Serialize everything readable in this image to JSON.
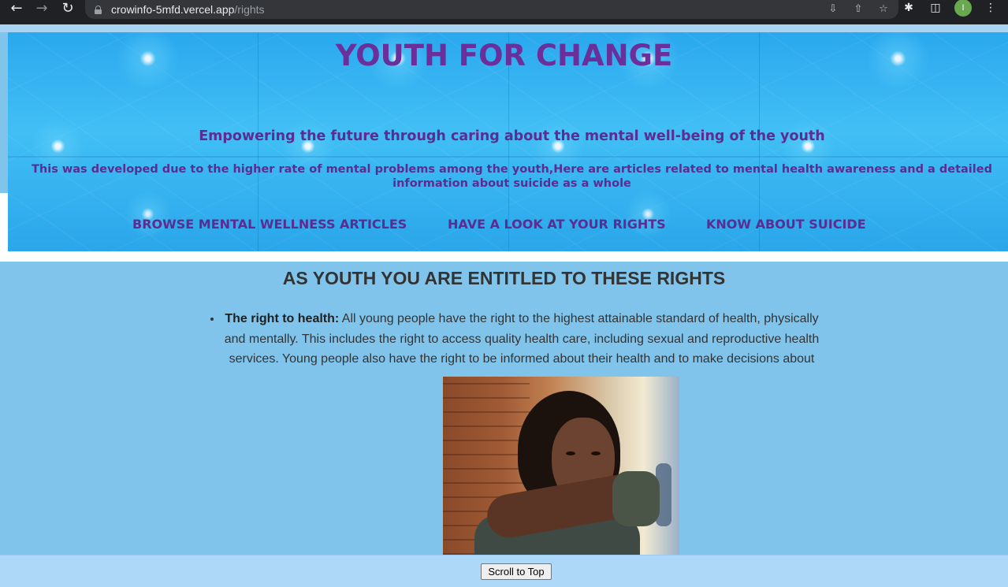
{
  "browser": {
    "url_host": "crowinfo-5mfd.vercel.app",
    "url_path": "/rights",
    "avatar_letter": "I",
    "icons": [
      "back-arrow-icon",
      "forward-arrow-icon",
      "reload-icon",
      "lock-icon",
      "install-icon",
      "share-icon",
      "star-icon",
      "puzzle-extension-icon",
      "side-panel-icon",
      "kebab-menu-icon"
    ]
  },
  "header": {
    "title": "YOUTH FOR CHANGE",
    "subtitle": "Empowering the future through caring about the mental well-being of the youth",
    "description": "This was developed due to the higher rate of mental problems among the youth,Here are articles related to mental health awareness and a detailed information about suicide as a whole",
    "nav": [
      {
        "label": "BROWSE MENTAL WELLNESS ARTICLES"
      },
      {
        "label": "HAVE A LOOK AT YOUR RIGHTS"
      },
      {
        "label": "KNOW ABOUT SUICIDE"
      }
    ]
  },
  "main": {
    "heading": "AS YOUTH YOU ARE ENTITLED TO THESE RIGHTS",
    "rights": [
      {
        "title": "The right to health:",
        "text": " All young people have the right to the highest attainable standard of health, physically and mentally. This includes the right to access quality health care, including sexual and reproductive health services. Young people also have the right to be informed about their health and to make decisions about"
      }
    ]
  },
  "footer": {
    "scroll_label": "Scroll to Top"
  },
  "colors": {
    "title_purple": "#6a2f9a",
    "text_purple": "#5b2c91",
    "page_bg": "#80c4ec",
    "footer_bg": "#add8f8"
  }
}
